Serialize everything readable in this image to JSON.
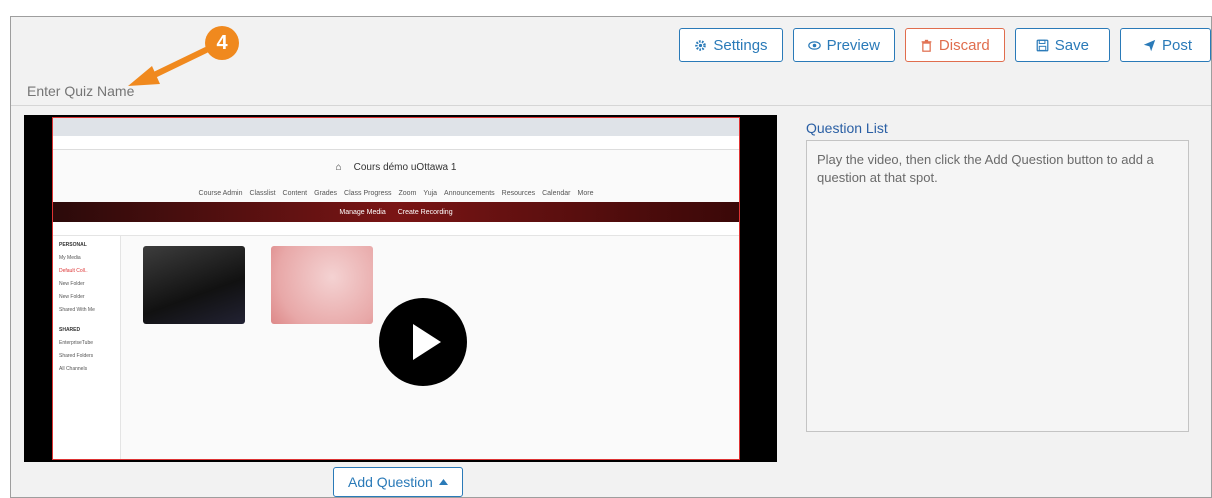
{
  "toolbar": {
    "settings_label": "Settings",
    "preview_label": "Preview",
    "discard_label": "Discard",
    "save_label": "Save",
    "post_label": "Post"
  },
  "quiz": {
    "name_placeholder": "Enter Quiz Name",
    "name_value": ""
  },
  "annotation": {
    "step_number": "4"
  },
  "video_screenshot": {
    "site_title": "Cours démo uOttawa 1",
    "nav_items": [
      "Course Admin",
      "Classlist",
      "Content",
      "Grades",
      "Class Progress",
      "Zoom",
      "Yuja",
      "Announcements",
      "Resources",
      "Calendar",
      "More"
    ],
    "manage_media": "Manage Media",
    "create_recording": "Create Recording",
    "sidebar_personal": "PERSONAL",
    "sidebar_items": [
      "My Media",
      "Default Coll..",
      "New Folder",
      "New Folder",
      "Shared With Me"
    ],
    "sidebar_shared": "SHARED",
    "sidebar_shared_items": [
      "EnterpriseTube",
      "Shared Folders",
      "All Channels"
    ]
  },
  "question_list": {
    "title": "Question List",
    "empty_text": "Play the video, then click the Add Question button to add a question at that spot."
  },
  "add_question": {
    "label": "Add Question"
  },
  "colors": {
    "accent_blue": "#2a7ab8",
    "discard_red": "#e06d4d",
    "annotation_orange": "#f0891e"
  }
}
